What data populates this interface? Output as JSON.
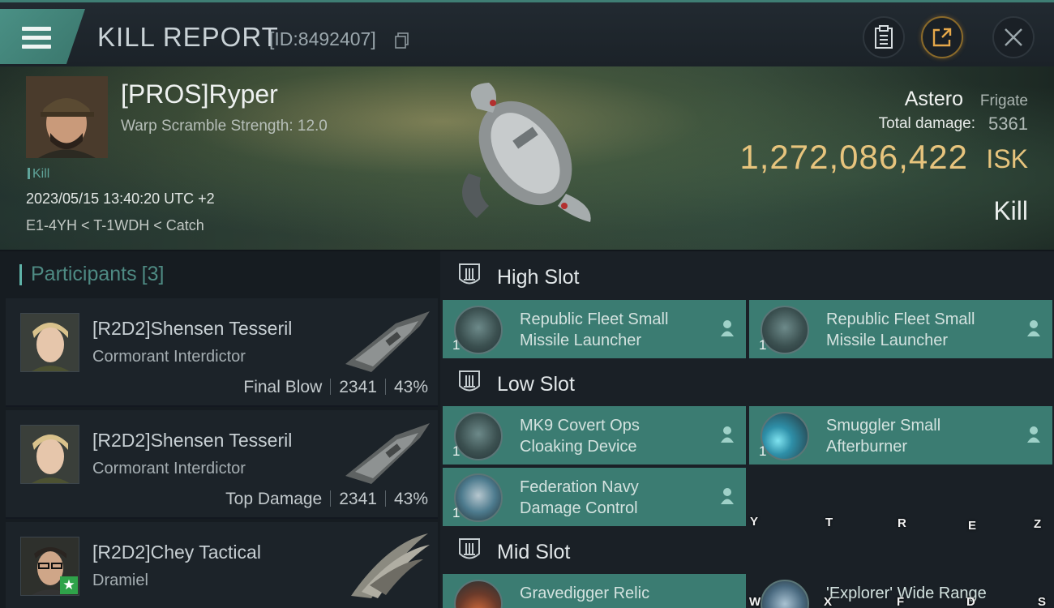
{
  "header": {
    "title": "KILL REPORT",
    "report_id": "[ID:8492407]"
  },
  "victim": {
    "name": "[PROS]Ryper",
    "warp_scramble": "Warp Scramble Strength: 12.0",
    "tag": "Kill",
    "timestamp": "2023/05/15 13:40:20 UTC +2",
    "location": "E1-4YH < T-1WDH < Catch",
    "ship_name": "Astero",
    "ship_class": "Frigate",
    "damage_label": "Total damage:",
    "damage_value": "5361",
    "isk_value": "1,272,086,422",
    "isk_label": "ISK",
    "result": "Kill"
  },
  "participants": {
    "label": "Participants",
    "count": "[3]",
    "rows": [
      {
        "name": "[R2D2]Shensen Tesseril",
        "ship": "Cormorant Interdictor",
        "role": "Final Blow",
        "damage": "2341",
        "percent": "43%"
      },
      {
        "name": "[R2D2]Shensen Tesseril",
        "ship": "Cormorant Interdictor",
        "role": "Top Damage",
        "damage": "2341",
        "percent": "43%"
      },
      {
        "name": "[R2D2]Chey Tactical",
        "ship": "Dramiel"
      }
    ]
  },
  "fitting": {
    "high_slot": "High Slot",
    "low_slot": "Low Slot",
    "mid_slot": "Mid Slot",
    "high_modules": [
      {
        "line1": "Republic Fleet Small",
        "line2": "Missile Launcher",
        "qty": "1"
      },
      {
        "line1": "Republic Fleet Small",
        "line2": "Missile Launcher",
        "qty": "1"
      }
    ],
    "low_modules": [
      {
        "line1": "MK9 Covert Ops",
        "line2": "Cloaking Device",
        "qty": "1"
      },
      {
        "line1": "Smuggler Small",
        "line2": "Afterburner",
        "qty": "1"
      },
      {
        "line1": "Federation Navy",
        "line2": "Damage Control",
        "qty": "1"
      }
    ],
    "mid_modules": [
      {
        "line1": "Gravedigger Relic"
      },
      {
        "line1": "'Explorer' Wide Range"
      }
    ]
  },
  "hotkeys": {
    "row1": [
      "Y",
      "T",
      "R",
      "E",
      "Z"
    ],
    "row2": [
      "W",
      "X",
      "F",
      "D",
      "S"
    ]
  },
  "colors": {
    "accent": "#3b7c72",
    "isk_gold": "#e7c47d",
    "header_bg": "#1b2228"
  }
}
